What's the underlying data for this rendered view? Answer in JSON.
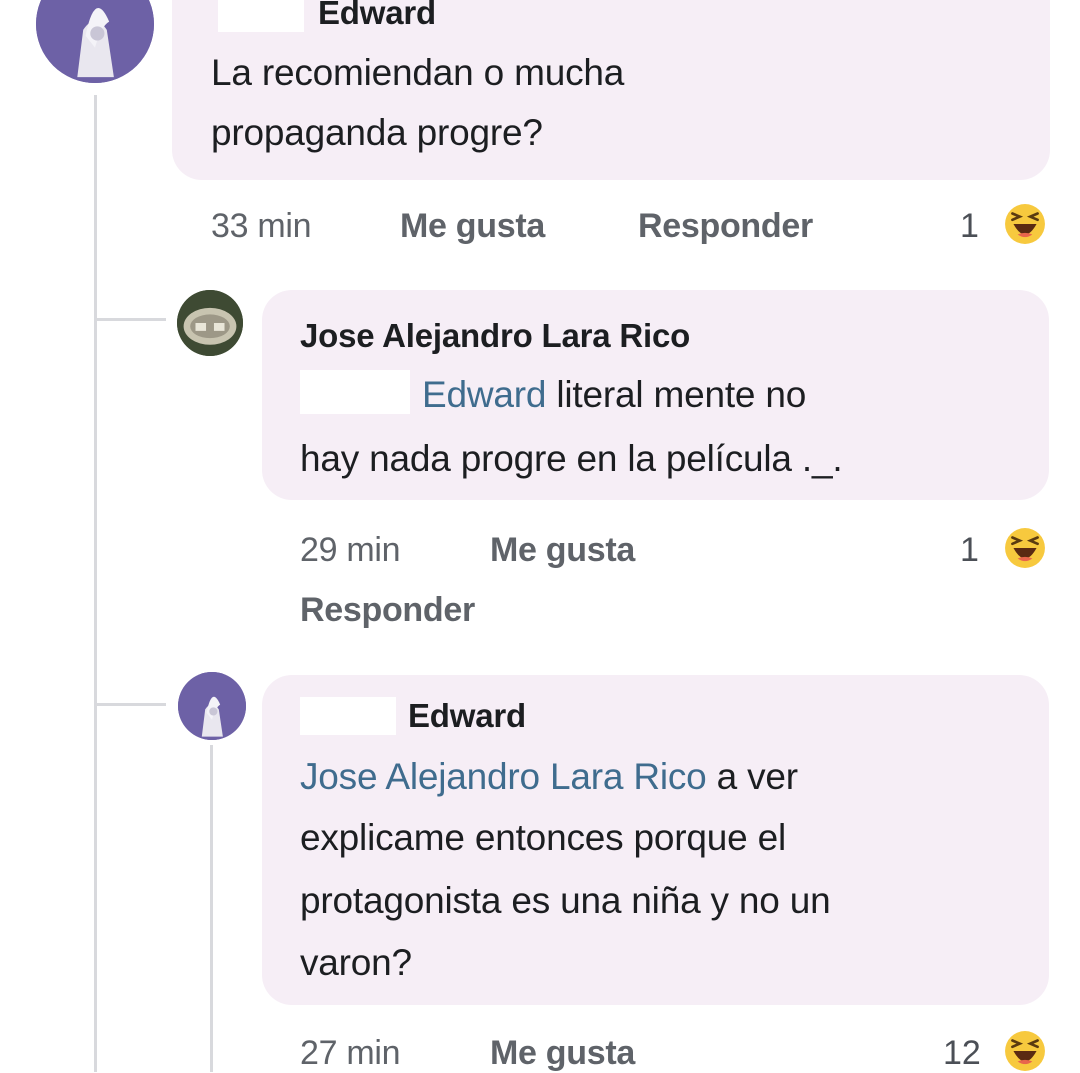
{
  "colors": {
    "bubble": "#f6eef6",
    "mention": "#3f6c8e",
    "meta": "#5f6369",
    "thread_line": "#d8d9dd"
  },
  "comments": [
    {
      "author": "Edward",
      "lines": [
        "La recomiendan o mucha",
        "propaganda progre?"
      ],
      "time": "33 min",
      "like_label": "Me gusta",
      "reply_label": "Responder",
      "reaction_count": "1",
      "reaction_icon": "haha-emoji-icon"
    },
    {
      "author": "Jose Alejandro Lara Rico",
      "mention": "Edward",
      "line1_rest": " literal mente no",
      "line2": "hay nada progre en la película ._.",
      "time": "29 min",
      "like_label": "Me gusta",
      "reply_label": "Responder",
      "reaction_count": "1",
      "reaction_icon": "haha-emoji-icon"
    },
    {
      "author": "Edward",
      "mention": "Jose Alejandro Lara Rico",
      "line1_rest": " a ver",
      "lines_rest": [
        "explicame entonces porque el",
        "protagonista es una niña y no un",
        "varon?"
      ],
      "time": "27 min",
      "like_label": "Me gusta",
      "reaction_count": "12",
      "reaction_icon": "haha-emoji-icon"
    }
  ]
}
